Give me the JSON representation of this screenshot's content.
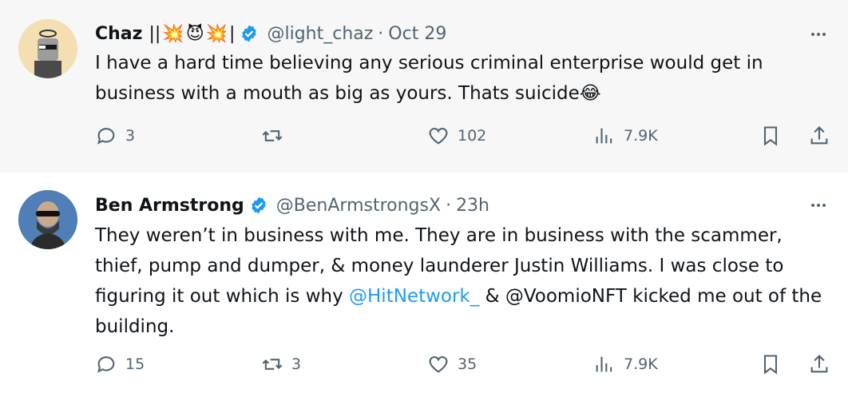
{
  "tweets": [
    {
      "author_name": "Chaz",
      "author_badges": [
        "||",
        "💥",
        "😈",
        "💥",
        "|"
      ],
      "handle": "@light_chaz",
      "time": "Oct 29",
      "text": "I have a hard time believing any serious criminal enterprise would get in business with a mouth as big as yours.  Thats suicide😂",
      "replies": "3",
      "retweets": "",
      "likes": "102",
      "views": "7.9K"
    },
    {
      "author_name": "Ben Armstrong",
      "handle": "@BenArmstrongsX",
      "time": "23h",
      "text_before": "They weren’t in business with me. They are in business with the scammer, thief, pump and dumper, & money launderer Justin Williams. I was close to figuring it out which is why ",
      "mention": "@HitNetwork_",
      "text_after": " & @VoomioNFT kicked me out of the building.",
      "replies": "15",
      "retweets": "3",
      "likes": "35",
      "views": "7.9K"
    }
  ],
  "colors": {
    "accent": "#1d9bf0",
    "secondary_text": "#536471",
    "thread_line": "#cfd9de",
    "highlight_bg": "#f7f7f7"
  },
  "icons": [
    "reply-icon",
    "retweet-icon",
    "like-icon",
    "views-icon",
    "bookmark-icon",
    "share-icon",
    "more-icon",
    "verified-badge-icon"
  ]
}
